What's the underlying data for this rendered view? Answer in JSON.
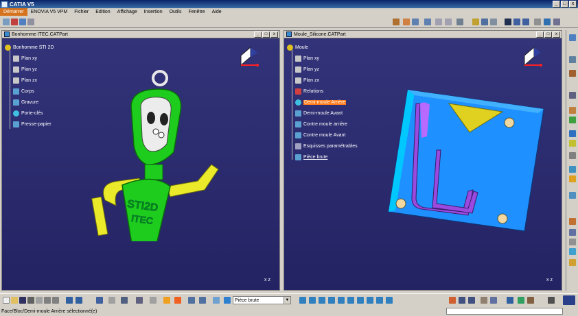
{
  "window": {
    "title": "CATIA V5",
    "min": "_",
    "max": "□",
    "close": "x"
  },
  "menu": [
    "Démarrer",
    "ENOVIA V5 VPM",
    "Fichier",
    "Edition",
    "Affichage",
    "Insertion",
    "Outils",
    "Fenêtre",
    "Aide"
  ],
  "doc_left": {
    "title": "Bonhomme ITEC.CATPart",
    "tree": [
      {
        "label": "Bonhomme STI 2D",
        "level": 0,
        "icon": "gear-icon"
      },
      {
        "label": "Plan xy",
        "level": 1,
        "icon": "plane-icon"
      },
      {
        "label": "Plan yz",
        "level": 1,
        "icon": "plane-icon"
      },
      {
        "label": "Plan zx",
        "level": 1,
        "icon": "plane-icon"
      },
      {
        "label": "Corps",
        "level": 1,
        "icon": "body-icon"
      },
      {
        "label": "Gravure",
        "level": 1,
        "icon": "body-icon"
      },
      {
        "label": "Porte-clés",
        "level": 1,
        "icon": "star-icon"
      },
      {
        "label": "Presse-papier",
        "level": 1,
        "icon": "body-icon"
      }
    ],
    "model_text": [
      "STI2D",
      "ITEC"
    ]
  },
  "doc_right": {
    "title": "Moule_Silicone.CATPart",
    "tree": [
      {
        "label": "Moule",
        "level": 0,
        "icon": "gear-icon"
      },
      {
        "label": "Plan xy",
        "level": 1,
        "icon": "plane-icon"
      },
      {
        "label": "Plan yz",
        "level": 1,
        "icon": "plane-icon"
      },
      {
        "label": "Plan zx",
        "level": 1,
        "icon": "plane-icon"
      },
      {
        "label": "Relations",
        "level": 1,
        "icon": "relations-icon"
      },
      {
        "label": "Demi-moule Arrière",
        "level": 1,
        "icon": "star-icon",
        "selected": true
      },
      {
        "label": "Demi-moule Avant",
        "level": 1,
        "icon": "body-icon"
      },
      {
        "label": "Contre moule arrière",
        "level": 1,
        "icon": "body-icon"
      },
      {
        "label": "Contre moule Avant",
        "level": 1,
        "icon": "body-icon"
      },
      {
        "label": "Esquisses paramétrables",
        "level": 1,
        "icon": "sketch-icon"
      },
      {
        "label": "Pièce brute",
        "level": 1,
        "icon": "body-icon",
        "underline": true
      }
    ]
  },
  "axis_label": "x z",
  "bottom_combo": {
    "value": "Pièce brute"
  },
  "status": {
    "text": "Face/Bloc/Demi-moule Arrière sélectionné(e)"
  },
  "colors": {
    "accent": "#ff7a1a",
    "viewport": "#2b2b6b",
    "mould": "#1e90ff",
    "part": "#22cc22"
  }
}
